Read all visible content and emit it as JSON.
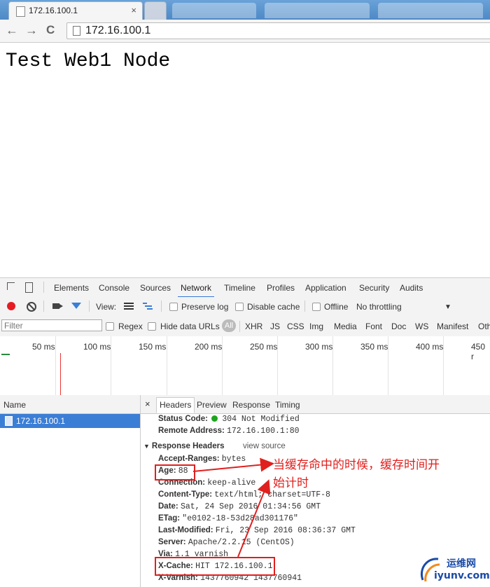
{
  "browser": {
    "tab_title": "172.16.100.1",
    "tab_close": "×",
    "address": "172.16.100.1",
    "back": "←",
    "forward": "→",
    "reload": "C"
  },
  "page": {
    "heading": "Test Web1 Node"
  },
  "devtools": {
    "tabs": [
      "Elements",
      "Console",
      "Sources",
      "Network",
      "Timeline",
      "Profiles",
      "Application",
      "Security",
      "Audits"
    ],
    "active_tab": "Network",
    "toolbar": {
      "view_label": "View:",
      "preserve_log": "Preserve log",
      "disable_cache": "Disable cache",
      "offline": "Offline",
      "throttling": "No throttling",
      "throttle_arrow": "▼"
    },
    "filter": {
      "placeholder": "Filter",
      "regex": "Regex",
      "hide_data_urls": "Hide data URLs",
      "types": [
        "All",
        "XHR",
        "JS",
        "CSS",
        "Img",
        "Media",
        "Font",
        "Doc",
        "WS",
        "Manifest",
        "Oth"
      ]
    },
    "timeline_ticks": [
      "50 ms",
      "100 ms",
      "150 ms",
      "200 ms",
      "250 ms",
      "300 ms",
      "350 ms",
      "400 ms",
      "450 r"
    ],
    "requests": {
      "column_header": "Name",
      "items": [
        "172.16.100.1"
      ]
    },
    "detail": {
      "close": "×",
      "tabs": [
        "Headers",
        "Preview",
        "Response",
        "Timing"
      ],
      "active_tab": "Headers",
      "general": [
        {
          "key": "Status Code:",
          "value": "304 Not Modified"
        },
        {
          "key": "Remote Address:",
          "value": "172.16.100.1:80"
        }
      ],
      "response_headers_title": "Response Headers",
      "view_source": "view source",
      "response_headers": [
        {
          "key": "Accept-Ranges:",
          "value": "bytes"
        },
        {
          "key": "Age:",
          "value": "88"
        },
        {
          "key": "Connection:",
          "value": "keep-alive"
        },
        {
          "key": "Content-Type:",
          "value": "text/html; charset=UTF-8"
        },
        {
          "key": "Date:",
          "value": "Sat, 24 Sep 2016 01:34:56 GMT"
        },
        {
          "key": "ETag:",
          "value": "\"e0102-18-53d28ad301176\""
        },
        {
          "key": "Last-Modified:",
          "value": "Fri, 23 Sep 2016 08:36:37 GMT"
        },
        {
          "key": "Server:",
          "value": "Apache/2.2.15 (CentOS)"
        },
        {
          "key": "Via:",
          "value": "1.1 varnish"
        },
        {
          "key": "X-Cache:",
          "value": "HIT 172.16.100.1"
        },
        {
          "key": "X-Varnish:",
          "value": "1437760942 1437760941"
        }
      ]
    }
  },
  "annotation": {
    "line1": "当缓存命中的时候，缓存时间开",
    "line2": "始计时",
    "color": "#e0201e"
  },
  "watermark": {
    "top": "运维网",
    "bottom": "iyunv.com"
  },
  "colors": {
    "accent": "#3b7ed6",
    "record": "#e51c23",
    "status_ok": "#1da51d"
  }
}
